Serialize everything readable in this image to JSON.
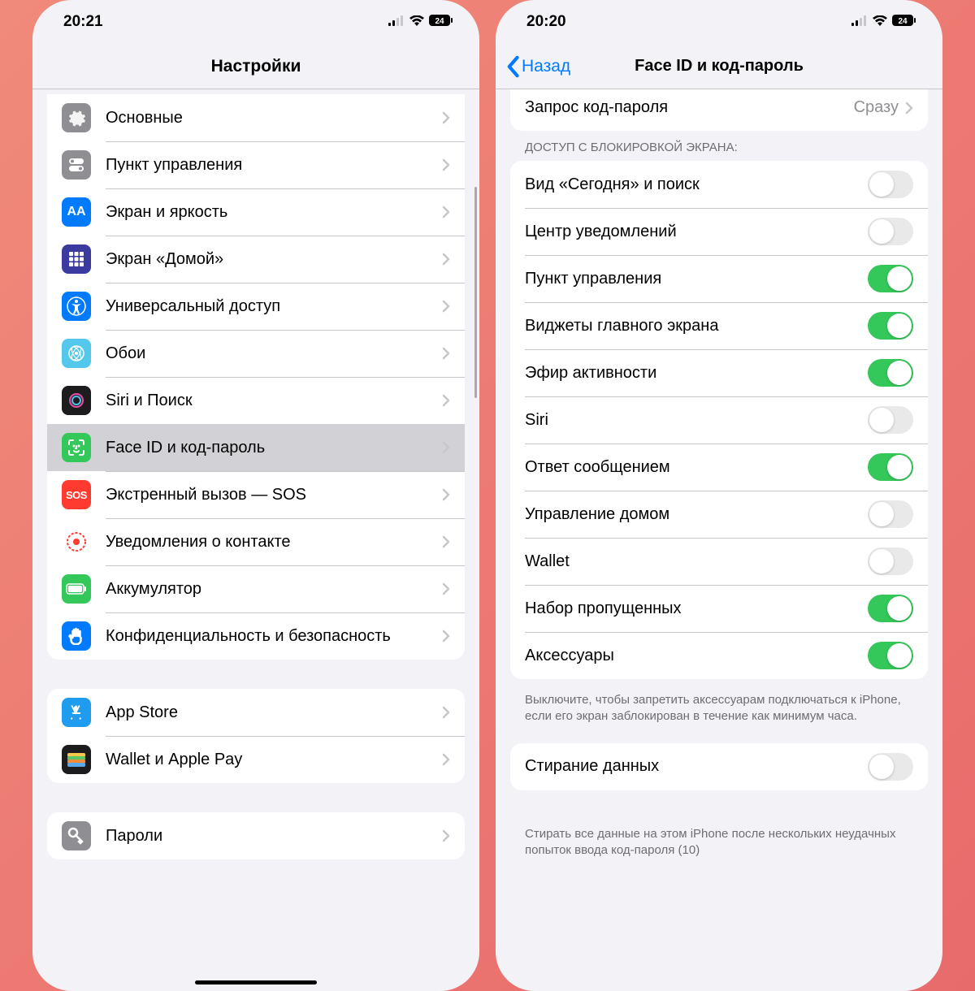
{
  "left": {
    "status": {
      "time": "20:21",
      "battery": "24"
    },
    "title": "Настройки",
    "groups": [
      {
        "rows": [
          {
            "label": "Основные",
            "icon": "gear-icon",
            "bg": "#8e8e93"
          },
          {
            "label": "Пункт управления",
            "icon": "toggles-icon",
            "bg": "#8e8e93"
          },
          {
            "label": "Экран и яркость",
            "icon": "display-icon",
            "bg": "#007aff"
          },
          {
            "label": "Экран «Домой»",
            "icon": "home-grid-icon",
            "bg": "#3a3a9f"
          },
          {
            "label": "Универсальный доступ",
            "icon": "accessibility-icon",
            "bg": "#007aff"
          },
          {
            "label": "Обои",
            "icon": "wallpaper-icon",
            "bg": "#54c7ec"
          },
          {
            "label": "Siri и Поиск",
            "icon": "siri-icon",
            "bg": "#1c1c1e"
          },
          {
            "label": "Face ID и код-пароль",
            "icon": "faceid-icon",
            "bg": "#34c759",
            "selected": true
          },
          {
            "label": "Экстренный вызов — SOS",
            "icon": "sos-icon",
            "bg": "#ff3b30"
          },
          {
            "label": "Уведомления о контакте",
            "icon": "exposure-icon",
            "bg": "#ffffff"
          },
          {
            "label": "Аккумулятор",
            "icon": "battery-icon",
            "bg": "#34c759"
          },
          {
            "label": "Конфиденциальность и безопасность",
            "icon": "hand-icon",
            "bg": "#007aff"
          }
        ]
      },
      {
        "rows": [
          {
            "label": "App Store",
            "icon": "appstore-icon",
            "bg": "#1f9cf0"
          },
          {
            "label": "Wallet и Apple Pay",
            "icon": "wallet-icon",
            "bg": "#1c1c1e"
          }
        ]
      },
      {
        "rows": [
          {
            "label": "Пароли",
            "icon": "key-icon",
            "bg": "#8e8e93"
          }
        ]
      }
    ]
  },
  "right": {
    "status": {
      "time": "20:20",
      "battery": "24"
    },
    "back": "Назад",
    "title": "Face ID и код-пароль",
    "partial_top": {
      "label": "Запрос код-пароля",
      "value": "Сразу"
    },
    "section_header": "ДОСТУП С БЛОКИРОВКОЙ ЭКРАНА:",
    "toggles": [
      {
        "label": "Вид «Сегодня» и поиск",
        "on": false
      },
      {
        "label": "Центр уведомлений",
        "on": false
      },
      {
        "label": "Пункт управления",
        "on": true
      },
      {
        "label": "Виджеты главного экрана",
        "on": true
      },
      {
        "label": "Эфир активности",
        "on": true
      },
      {
        "label": "Siri",
        "on": false
      },
      {
        "label": "Ответ сообщением",
        "on": true
      },
      {
        "label": "Управление домом",
        "on": false
      },
      {
        "label": "Wallet",
        "on": false
      },
      {
        "label": "Набор пропущенных",
        "on": true
      },
      {
        "label": "Аксессуары",
        "on": true
      }
    ],
    "footer1": "Выключите, чтобы запретить аксессуарам подключаться к iPhone, если его экран заблокирован в течение как минимум часа.",
    "erase": {
      "label": "Стирание данных",
      "on": false
    },
    "footer2": "Стирать все данные на этом iPhone после нескольких неудачных попыток ввода код-пароля (10)"
  }
}
